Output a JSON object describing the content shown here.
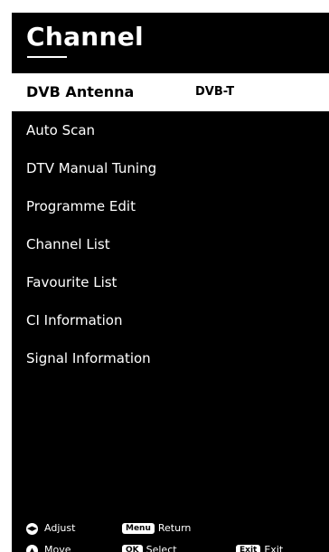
{
  "header": {
    "title": "Channel"
  },
  "menu": {
    "items": [
      {
        "label": "DVB Antenna",
        "value": "DVB-T"
      },
      {
        "label": "Auto Scan"
      },
      {
        "label": "DTV Manual Tuning"
      },
      {
        "label": "Programme Edit"
      },
      {
        "label": "Channel List"
      },
      {
        "label": "Favourite List"
      },
      {
        "label": "CI Information"
      },
      {
        "label": "Signal Information"
      }
    ]
  },
  "legend": {
    "adjust": {
      "icon": "left-right-dpad-icon",
      "label": "Adjust"
    },
    "return": {
      "key": "Menu",
      "label": "Return"
    },
    "move": {
      "icon": "up-down-dpad-icon",
      "label": "Move"
    },
    "select": {
      "key": "OK",
      "label": "Select"
    },
    "exit": {
      "key": "Exit",
      "label": "Exit"
    }
  },
  "colors": {
    "background": "#000000",
    "text": "#ffffff",
    "selection": "#ffffff"
  }
}
